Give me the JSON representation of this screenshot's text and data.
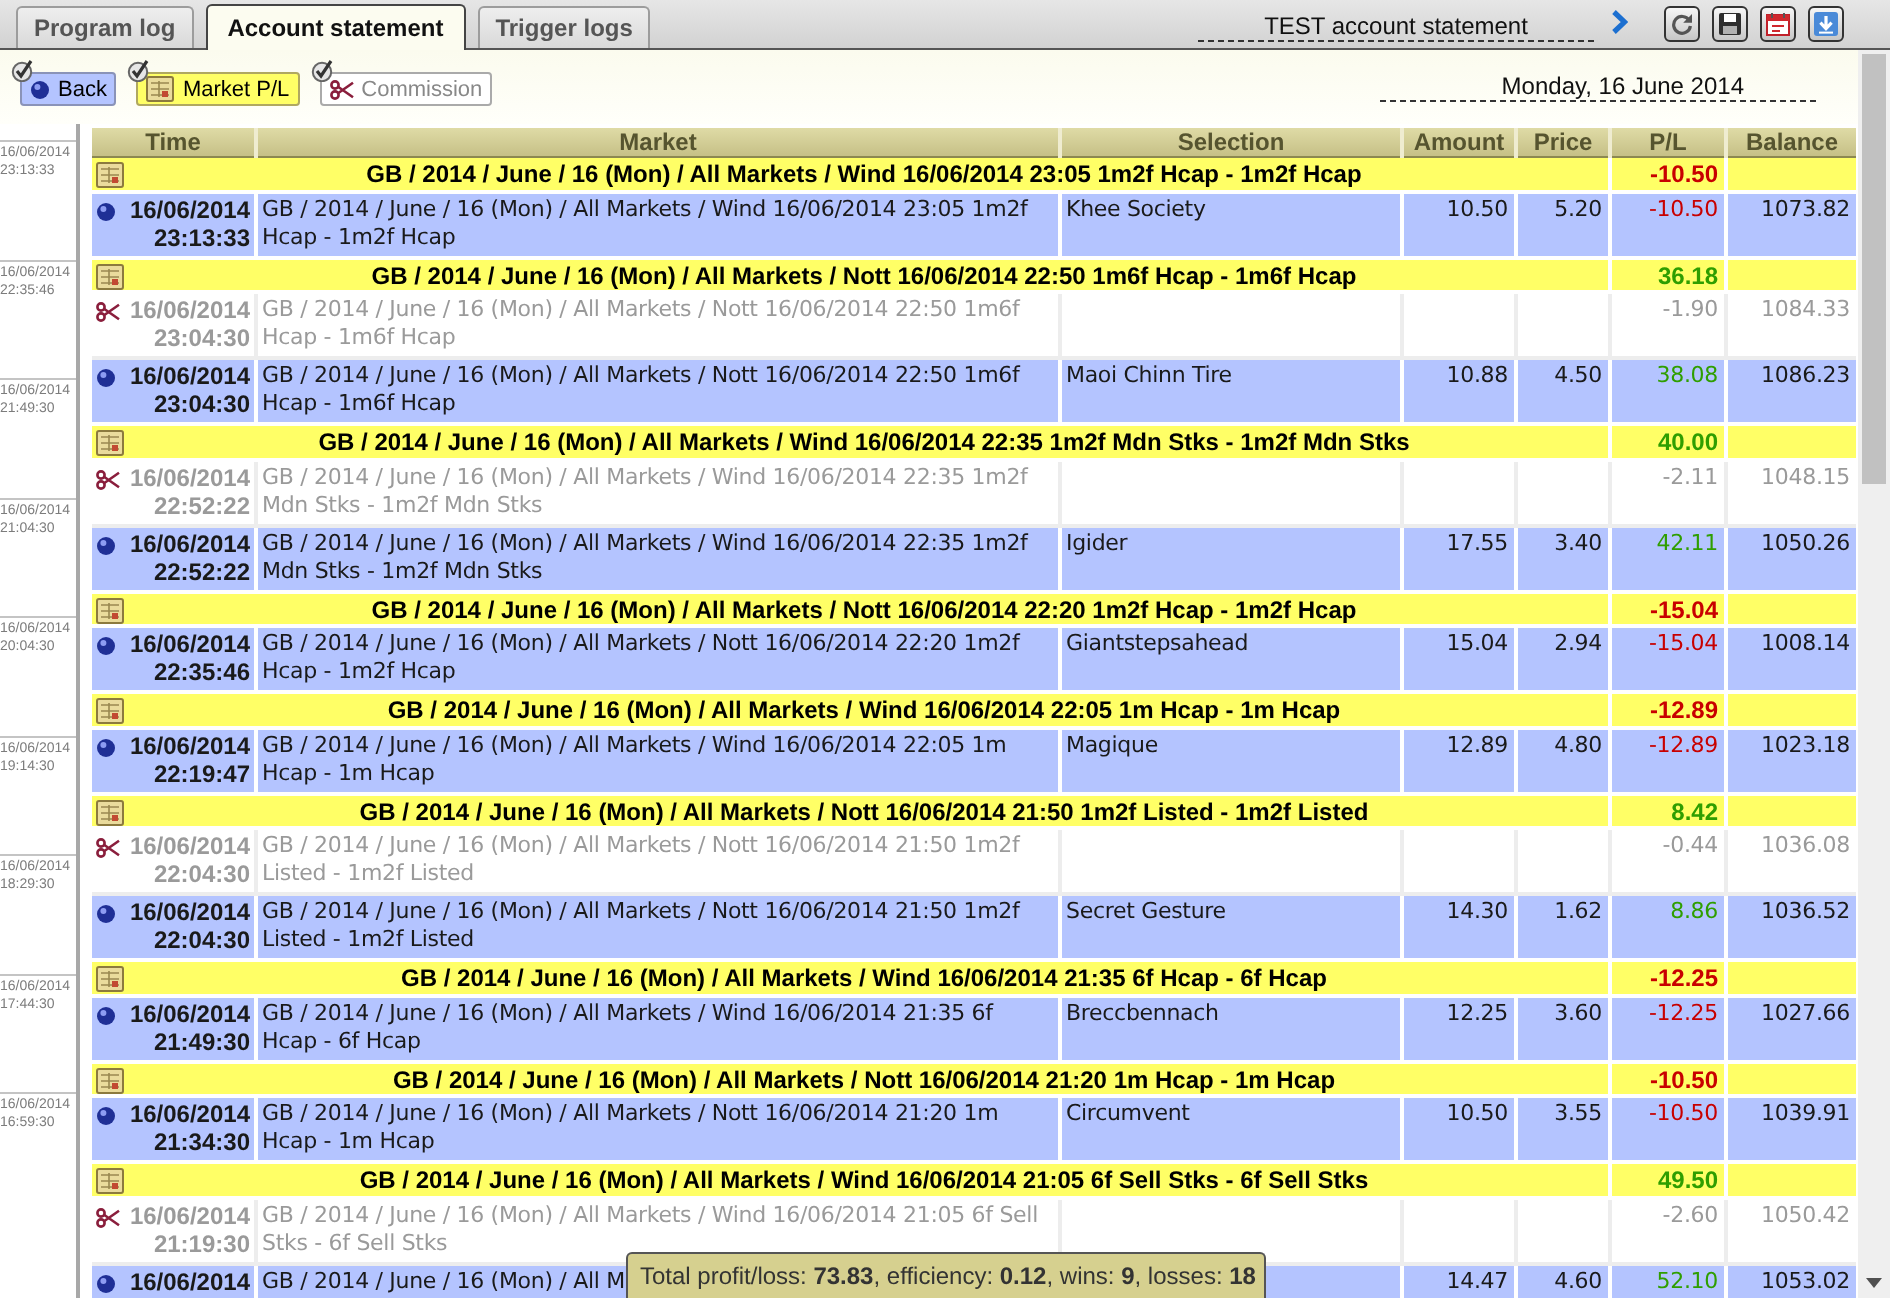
{
  "tabs": [
    {
      "label": "Program log",
      "selected": false
    },
    {
      "label": "Account statement",
      "selected": true
    },
    {
      "label": "Trigger logs",
      "selected": false
    }
  ],
  "header": {
    "title": "TEST account statement"
  },
  "filters": [
    {
      "kind": "bet",
      "label": "Back",
      "checked": true
    },
    {
      "kind": "market",
      "label": "Market P/L",
      "checked": true
    },
    {
      "kind": "commission",
      "label": "Commission",
      "checked": true
    }
  ],
  "date": "Monday, 16 June 2014",
  "timeline": [
    {
      "date": "16/06/2014",
      "time": "23:13:33"
    },
    {
      "date": "16/06/2014",
      "time": "22:35:46"
    },
    {
      "date": "16/06/2014",
      "time": "21:49:30"
    },
    {
      "date": "16/06/2014",
      "time": "21:04:30"
    },
    {
      "date": "16/06/2014",
      "time": "20:04:30"
    },
    {
      "date": "16/06/2014",
      "time": "19:14:30"
    },
    {
      "date": "16/06/2014",
      "time": "18:29:30"
    },
    {
      "date": "16/06/2014",
      "time": "17:44:30"
    },
    {
      "date": "16/06/2014",
      "time": "16:59:30"
    }
  ],
  "table": {
    "columns": [
      "Time",
      "Market",
      "Selection",
      "Amount",
      "Price",
      "P/L",
      "Balance"
    ],
    "rows": [
      {
        "kind": "market",
        "market": "GB / 2014 / June / 16 (Mon) / All Markets / Wind 16/06/2014 23:05 1m2f Hcap - 1m2f Hcap",
        "pl": "-10.50",
        "loss": true
      },
      {
        "kind": "bet",
        "date": "16/06/2014",
        "time": "23:13:33",
        "market": "GB / 2014 / June / 16 (Mon) / All Markets / Wind 16/06/2014 23:05 1m2f Hcap - 1m2f Hcap",
        "selection": "Khee Society",
        "amount": "10.50",
        "price": "5.20",
        "pl": "-10.50",
        "loss": true,
        "balance": "1073.82"
      },
      {
        "kind": "market",
        "market": "GB / 2014 / June / 16 (Mon) / All Markets / Nott 16/06/2014 22:50 1m6f Hcap - 1m6f Hcap",
        "pl": "36.18",
        "loss": false
      },
      {
        "kind": "commission",
        "date": "16/06/2014",
        "time": "23:04:30",
        "market": "GB / 2014 / June / 16 (Mon) / All Markets / Nott 16/06/2014 22:50 1m6f Hcap - 1m6f Hcap",
        "pl": "-1.90",
        "balance": "1084.33"
      },
      {
        "kind": "bet",
        "date": "16/06/2014",
        "time": "23:04:30",
        "market": "GB / 2014 / June / 16 (Mon) / All Markets / Nott 16/06/2014 22:50 1m6f Hcap - 1m6f Hcap",
        "selection": "Maoi Chinn Tire",
        "amount": "10.88",
        "price": "4.50",
        "pl": "38.08",
        "loss": false,
        "balance": "1086.23"
      },
      {
        "kind": "market",
        "market": "GB / 2014 / June / 16 (Mon) / All Markets / Wind 16/06/2014 22:35 1m2f Mdn Stks - 1m2f Mdn Stks",
        "pl": "40.00",
        "loss": false
      },
      {
        "kind": "commission",
        "date": "16/06/2014",
        "time": "22:52:22",
        "market": "GB / 2014 / June / 16 (Mon) / All Markets / Wind 16/06/2014 22:35 1m2f Mdn Stks - 1m2f Mdn Stks",
        "pl": "-2.11",
        "balance": "1048.15"
      },
      {
        "kind": "bet",
        "date": "16/06/2014",
        "time": "22:52:22",
        "market": "GB / 2014 / June / 16 (Mon) / All Markets / Wind 16/06/2014 22:35 1m2f Mdn Stks - 1m2f Mdn Stks",
        "selection": "Igider",
        "amount": "17.55",
        "price": "3.40",
        "pl": "42.11",
        "loss": false,
        "balance": "1050.26"
      },
      {
        "kind": "market",
        "market": "GB / 2014 / June / 16 (Mon) / All Markets / Nott 16/06/2014 22:20 1m2f Hcap - 1m2f Hcap",
        "pl": "-15.04",
        "loss": true
      },
      {
        "kind": "bet",
        "date": "16/06/2014",
        "time": "22:35:46",
        "market": "GB / 2014 / June / 16 (Mon) / All Markets / Nott 16/06/2014 22:20 1m2f Hcap - 1m2f Hcap",
        "selection": "Giantstepsahead",
        "amount": "15.04",
        "price": "2.94",
        "pl": "-15.04",
        "loss": true,
        "balance": "1008.14"
      },
      {
        "kind": "market",
        "market": "GB / 2014 / June / 16 (Mon) / All Markets / Wind 16/06/2014 22:05 1m Hcap - 1m Hcap",
        "pl": "-12.89",
        "loss": true
      },
      {
        "kind": "bet",
        "date": "16/06/2014",
        "time": "22:19:47",
        "market": "GB / 2014 / June / 16 (Mon) / All Markets / Wind 16/06/2014 22:05 1m Hcap - 1m Hcap",
        "selection": "Magique",
        "amount": "12.89",
        "price": "4.80",
        "pl": "-12.89",
        "loss": true,
        "balance": "1023.18"
      },
      {
        "kind": "market",
        "market": "GB / 2014 / June / 16 (Mon) / All Markets / Nott 16/06/2014 21:50 1m2f Listed - 1m2f Listed",
        "pl": "8.42",
        "loss": false
      },
      {
        "kind": "commission",
        "date": "16/06/2014",
        "time": "22:04:30",
        "market": "GB / 2014 / June / 16 (Mon) / All Markets / Nott 16/06/2014 21:50 1m2f Listed - 1m2f Listed",
        "pl": "-0.44",
        "balance": "1036.08"
      },
      {
        "kind": "bet",
        "date": "16/06/2014",
        "time": "22:04:30",
        "market": "GB / 2014 / June / 16 (Mon) / All Markets / Nott 16/06/2014 21:50 1m2f Listed - 1m2f Listed",
        "selection": "Secret Gesture",
        "amount": "14.30",
        "price": "1.62",
        "pl": "8.86",
        "loss": false,
        "balance": "1036.52"
      },
      {
        "kind": "market",
        "market": "GB / 2014 / June / 16 (Mon) / All Markets / Wind 16/06/2014 21:35 6f Hcap - 6f Hcap",
        "pl": "-12.25",
        "loss": true
      },
      {
        "kind": "bet",
        "date": "16/06/2014",
        "time": "21:49:30",
        "market": "GB / 2014 / June / 16 (Mon) / All Markets / Wind 16/06/2014 21:35 6f Hcap - 6f Hcap",
        "selection": "Breccbennach",
        "amount": "12.25",
        "price": "3.60",
        "pl": "-12.25",
        "loss": true,
        "balance": "1027.66"
      },
      {
        "kind": "market",
        "market": "GB / 2014 / June / 16 (Mon) / All Markets / Nott 16/06/2014 21:20 1m Hcap - 1m Hcap",
        "pl": "-10.50",
        "loss": true
      },
      {
        "kind": "bet",
        "date": "16/06/2014",
        "time": "21:34:30",
        "market": "GB / 2014 / June / 16 (Mon) / All Markets / Nott 16/06/2014 21:20 1m Hcap - 1m Hcap",
        "selection": "Circumvent",
        "amount": "10.50",
        "price": "3.55",
        "pl": "-10.50",
        "loss": true,
        "balance": "1039.91"
      },
      {
        "kind": "market",
        "market": "GB / 2014 / June / 16 (Mon) / All Markets / Wind 16/06/2014 21:05 6f Sell Stks - 6f Sell Stks",
        "pl": "49.50",
        "loss": false
      },
      {
        "kind": "commission",
        "date": "16/06/2014",
        "time": "21:19:30",
        "market": "GB / 2014 / June / 16 (Mon) / All Markets / Wind 16/06/2014 21:05 6f Sell Stks - 6f Sell Stks",
        "pl": "-2.60",
        "balance": "1050.42"
      },
      {
        "kind": "bet",
        "date": "16/06/2014",
        "market": "GB / 2014 / June / 16 (Mon) / All M",
        "amount": "14.47",
        "price": "4.60",
        "pl": "52.10",
        "loss": false,
        "balance": "1053.02"
      }
    ]
  },
  "summary": "Total profit/loss: **73.83**, efficiency: **0.12**, wins: **9**, losses: **18**"
}
